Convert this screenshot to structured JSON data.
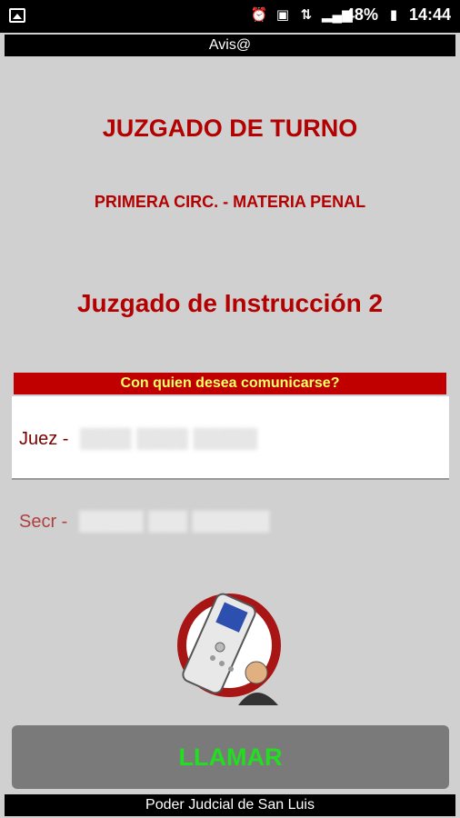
{
  "status_bar": {
    "battery": "48%",
    "time": "14:44",
    "icons": [
      "image-icon",
      "alarm-icon",
      "volte-icon",
      "data-arrows-icon",
      "signal-icon",
      "battery-icon"
    ]
  },
  "header": {
    "app_title": "Avis@"
  },
  "main": {
    "title": "JUZGADO DE TURNO",
    "subtitle": "PRIMERA CIRC. - MATERIA PENAL",
    "court": "Juzgado de Instrucción 2",
    "prompt": "Con quien desea comunicarse?",
    "options": [
      {
        "label": "Juez -",
        "name": "redacted"
      },
      {
        "label": "Secr -",
        "name": "redacted"
      }
    ]
  },
  "call_button": {
    "label": "LLAMAR"
  },
  "footer": {
    "text": "Poder Judcial de San Luis"
  },
  "colors": {
    "title_red": "#b30000",
    "bar_red": "#c00000",
    "prompt_yellow": "#ffff66",
    "call_green": "#22dd22",
    "background": "#d0d0d0"
  }
}
